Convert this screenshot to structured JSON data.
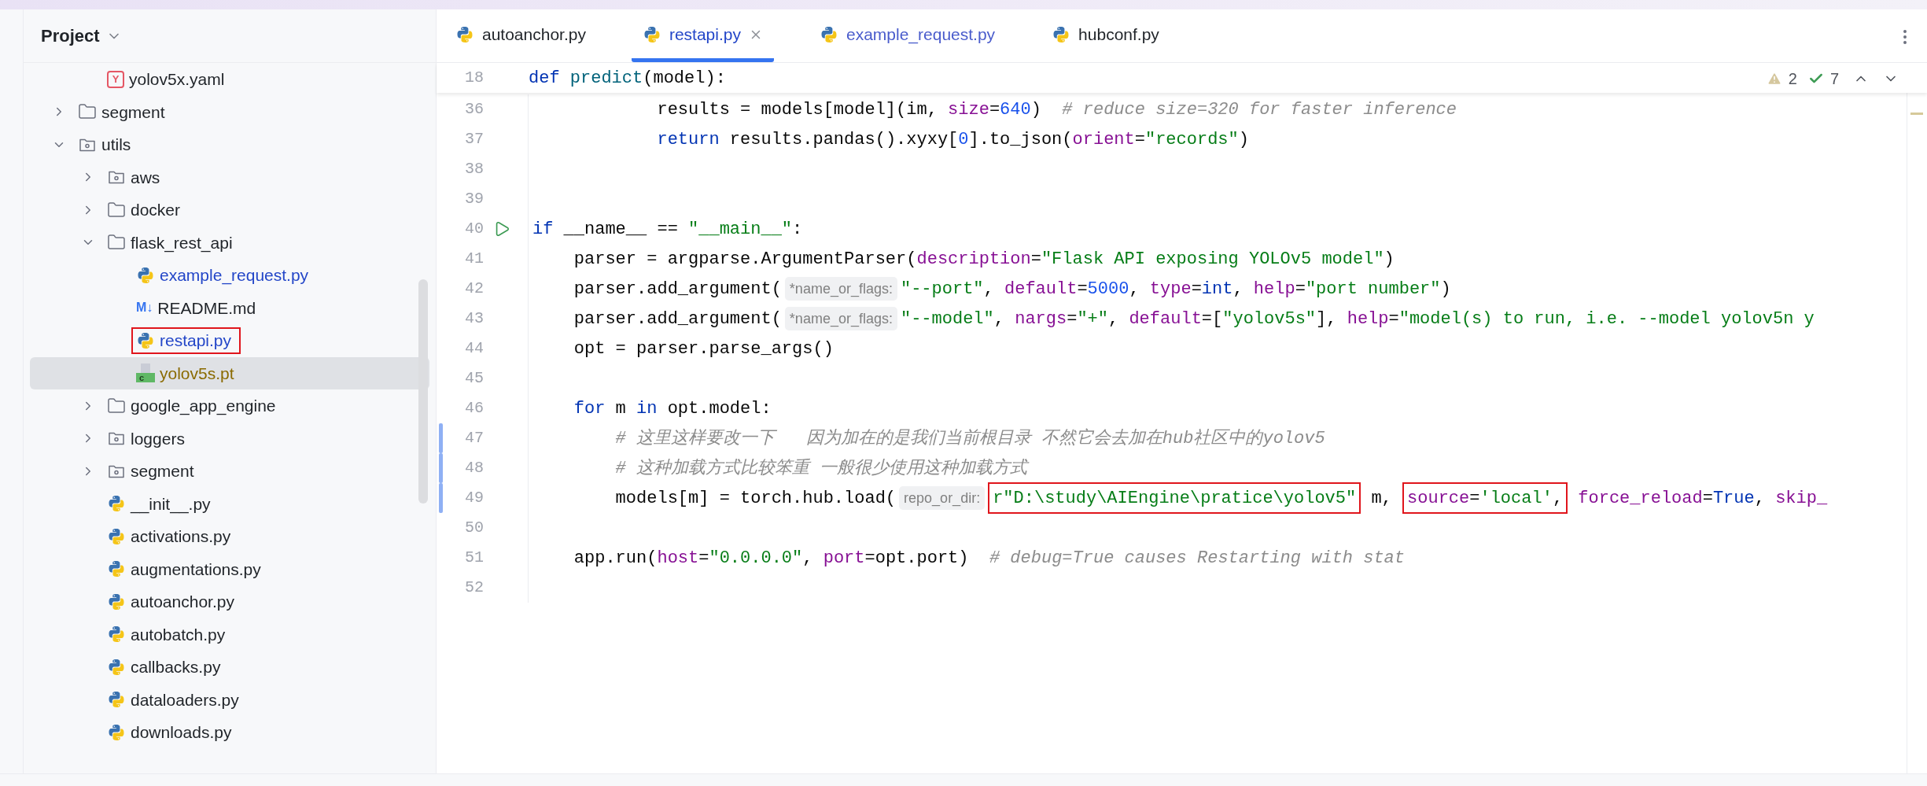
{
  "project_panel": {
    "title": "Project",
    "tree_partial": [
      {
        "label": "yolov5x.yaml",
        "kind": "yaml",
        "icon_label": "Y",
        "modified": false,
        "ignored": false,
        "selected": false,
        "highlighted": false
      }
    ],
    "tree": [
      {
        "label": "segment",
        "kind": "folder",
        "modified": false,
        "ignored": false,
        "selected": false,
        "highlighted": false,
        "expanded": false
      },
      {
        "label": "utils",
        "kind": "package",
        "modified": false,
        "ignored": false,
        "selected": false,
        "highlighted": false,
        "expanded": true,
        "children": [
          {
            "label": "aws",
            "kind": "package",
            "modified": false,
            "ignored": false,
            "selected": false,
            "highlighted": false,
            "expanded": false
          },
          {
            "label": "docker",
            "kind": "folder",
            "modified": false,
            "ignored": false,
            "selected": false,
            "highlighted": false,
            "expanded": false
          },
          {
            "label": "flask_rest_api",
            "kind": "folder",
            "modified": false,
            "ignored": false,
            "selected": false,
            "highlighted": false,
            "expanded": true,
            "children": [
              {
                "label": "example_request.py",
                "kind": "python",
                "modified": true,
                "ignored": false,
                "selected": false,
                "highlighted": false
              },
              {
                "label": "README.md",
                "kind": "markdown",
                "icon_label": "M↓",
                "modified": false,
                "ignored": false,
                "selected": false,
                "highlighted": false
              },
              {
                "label": "restapi.py",
                "kind": "python",
                "modified": true,
                "ignored": false,
                "selected": false,
                "highlighted": true
              },
              {
                "label": "yolov5s.pt",
                "kind": "binary",
                "icon_label": "c",
                "modified": false,
                "ignored": true,
                "selected": true,
                "highlighted": false
              }
            ]
          },
          {
            "label": "google_app_engine",
            "kind": "folder",
            "modified": false,
            "ignored": false,
            "selected": false,
            "highlighted": false,
            "expanded": false
          },
          {
            "label": "loggers",
            "kind": "package",
            "modified": false,
            "ignored": false,
            "selected": false,
            "highlighted": false,
            "expanded": false
          },
          {
            "label": "segment",
            "kind": "package",
            "modified": false,
            "ignored": false,
            "selected": false,
            "highlighted": false,
            "expanded": false
          },
          {
            "label": "__init__.py",
            "kind": "python",
            "modified": false,
            "ignored": false,
            "selected": false,
            "highlighted": false
          },
          {
            "label": "activations.py",
            "kind": "python",
            "modified": false,
            "ignored": false,
            "selected": false,
            "highlighted": false
          },
          {
            "label": "augmentations.py",
            "kind": "python",
            "modified": false,
            "ignored": false,
            "selected": false,
            "highlighted": false
          },
          {
            "label": "autoanchor.py",
            "kind": "python",
            "modified": false,
            "ignored": false,
            "selected": false,
            "highlighted": false
          },
          {
            "label": "autobatch.py",
            "kind": "python",
            "modified": false,
            "ignored": false,
            "selected": false,
            "highlighted": false
          },
          {
            "label": "callbacks.py",
            "kind": "python",
            "modified": false,
            "ignored": false,
            "selected": false,
            "highlighted": false
          },
          {
            "label": "dataloaders.py",
            "kind": "python",
            "modified": false,
            "ignored": false,
            "selected": false,
            "highlighted": false
          },
          {
            "label": "downloads.py",
            "kind": "python",
            "modified": false,
            "ignored": false,
            "selected": false,
            "highlighted": false
          }
        ]
      }
    ]
  },
  "editor": {
    "tabs": [
      {
        "label": "autoanchor.py",
        "modified": false,
        "selected": false
      },
      {
        "label": "restapi.py",
        "modified": true,
        "selected": true
      },
      {
        "label": "example_request.py",
        "modified": true,
        "selected": false
      },
      {
        "label": "hubconf.py",
        "modified": false,
        "selected": false
      }
    ],
    "inspections": {
      "warnings": "2",
      "typos": "7"
    },
    "sticky_line": {
      "number": "18",
      "tokens": [
        {
          "kind": "kw",
          "text": "def"
        },
        {
          "kind": "fn",
          "text": " predict"
        },
        {
          "kind": "plain",
          "text": "(model):"
        }
      ]
    },
    "lines": [
      {
        "number": "36",
        "run": false,
        "changed": false,
        "tokens": [
          {
            "kind": "plain",
            "text": "            results = models[model](im, "
          },
          {
            "kind": "param",
            "text": "size"
          },
          {
            "kind": "plain",
            "text": "="
          },
          {
            "kind": "num",
            "text": "640"
          },
          {
            "kind": "plain",
            "text": ")  "
          },
          {
            "kind": "comment",
            "text": "# reduce size=320 for faster inference"
          }
        ]
      },
      {
        "number": "37",
        "run": false,
        "changed": false,
        "tokens": [
          {
            "kind": "kw",
            "text": "            return"
          },
          {
            "kind": "plain",
            "text": " results.pandas().xyxy["
          },
          {
            "kind": "num",
            "text": "0"
          },
          {
            "kind": "plain",
            "text": "].to_json("
          },
          {
            "kind": "param",
            "text": "orient"
          },
          {
            "kind": "plain",
            "text": "="
          },
          {
            "kind": "str",
            "text": "\"records\""
          },
          {
            "kind": "plain",
            "text": ")"
          }
        ]
      },
      {
        "number": "38",
        "run": false,
        "changed": false
      },
      {
        "number": "39",
        "run": false,
        "changed": false
      },
      {
        "number": "40",
        "run": true,
        "changed": false,
        "tokens": [
          {
            "kind": "kw",
            "text": "if"
          },
          {
            "kind": "plain",
            "text": " __name__ == "
          },
          {
            "kind": "str",
            "text": "\"__main__\""
          },
          {
            "kind": "plain",
            "text": ":"
          }
        ]
      },
      {
        "number": "41",
        "run": false,
        "changed": false,
        "tokens": [
          {
            "kind": "plain",
            "text": "    parser = argparse.ArgumentParser("
          },
          {
            "kind": "param",
            "text": "description"
          },
          {
            "kind": "plain",
            "text": "="
          },
          {
            "kind": "str",
            "text": "\"Flask API exposing YOLOv5 model\""
          },
          {
            "kind": "plain",
            "text": ")"
          }
        ]
      },
      {
        "number": "42",
        "run": false,
        "changed": false,
        "tokens": [
          {
            "kind": "plain",
            "text": "    parser.add_argument("
          },
          {
            "kind": "hint",
            "text": "*name_or_flags:"
          },
          {
            "kind": "str",
            "text": "\"--port\""
          },
          {
            "kind": "plain",
            "text": ", "
          },
          {
            "kind": "param",
            "text": "default"
          },
          {
            "kind": "plain",
            "text": "="
          },
          {
            "kind": "num",
            "text": "5000"
          },
          {
            "kind": "plain",
            "text": ", "
          },
          {
            "kind": "param",
            "text": "type"
          },
          {
            "kind": "plain",
            "text": "="
          },
          {
            "kind": "kw",
            "text": "int"
          },
          {
            "kind": "plain",
            "text": ", "
          },
          {
            "kind": "param",
            "text": "help"
          },
          {
            "kind": "plain",
            "text": "="
          },
          {
            "kind": "str",
            "text": "\"port number\""
          },
          {
            "kind": "plain",
            "text": ")"
          }
        ]
      },
      {
        "number": "43",
        "run": false,
        "changed": false,
        "tokens": [
          {
            "kind": "plain",
            "text": "    parser.add_argument("
          },
          {
            "kind": "hint",
            "text": "*name_or_flags:"
          },
          {
            "kind": "str",
            "text": "\"--model\""
          },
          {
            "kind": "plain",
            "text": ", "
          },
          {
            "kind": "param",
            "text": "nargs"
          },
          {
            "kind": "plain",
            "text": "="
          },
          {
            "kind": "str",
            "text": "\"+\""
          },
          {
            "kind": "plain",
            "text": ", "
          },
          {
            "kind": "param",
            "text": "default"
          },
          {
            "kind": "plain",
            "text": "=["
          },
          {
            "kind": "str",
            "text": "\"yolov5s\""
          },
          {
            "kind": "plain",
            "text": "], "
          },
          {
            "kind": "param",
            "text": "help"
          },
          {
            "kind": "plain",
            "text": "="
          },
          {
            "kind": "str",
            "text": "\"model(s) to run, i.e. --model yolov5n y"
          }
        ]
      },
      {
        "number": "44",
        "run": false,
        "changed": false,
        "tokens": [
          {
            "kind": "plain",
            "text": "    opt = parser.parse_args()"
          }
        ]
      },
      {
        "number": "45",
        "run": false,
        "changed": false
      },
      {
        "number": "46",
        "run": false,
        "changed": false,
        "tokens": [
          {
            "kind": "kw",
            "text": "    for"
          },
          {
            "kind": "plain",
            "text": " m "
          },
          {
            "kind": "kw",
            "text": "in"
          },
          {
            "kind": "plain",
            "text": " opt.model:"
          }
        ]
      },
      {
        "number": "47",
        "run": false,
        "changed": true,
        "tokens": [
          {
            "kind": "comment",
            "text": "        # 这里这样要改一下   因为加在的是我们当前根目录 不然它会去加在hub社区中的yolov5"
          }
        ]
      },
      {
        "number": "48",
        "run": false,
        "changed": true,
        "tokens": [
          {
            "kind": "comment",
            "text": "        # 这种加载方式比较笨重 一般很少使用这种加载方式"
          }
        ]
      },
      {
        "number": "49",
        "run": false,
        "changed": true,
        "tokens": [
          {
            "kind": "plain",
            "text": "        models[m] = torch.hub.load("
          },
          {
            "kind": "hint",
            "text": "repo_or_dir:"
          },
          {
            "kind": "boxed",
            "tokens": [
              {
                "kind": "str",
                "text": "r\"D:\\study\\AIEngine\\pratice\\yolov5\""
              }
            ]
          },
          {
            "kind": "plain",
            "text": " m, "
          },
          {
            "kind": "boxed",
            "tokens": [
              {
                "kind": "param",
                "text": "source"
              },
              {
                "kind": "plain",
                "text": "="
              },
              {
                "kind": "str",
                "text": "'local'"
              },
              {
                "kind": "plain",
                "text": ","
              }
            ]
          },
          {
            "kind": "param",
            "text": " force_reload"
          },
          {
            "kind": "plain",
            "text": "="
          },
          {
            "kind": "kw",
            "text": "True"
          },
          {
            "kind": "plain",
            "text": ", "
          },
          {
            "kind": "param",
            "text": "skip_"
          }
        ]
      },
      {
        "number": "50",
        "run": false,
        "changed": false
      },
      {
        "number": "51",
        "run": false,
        "changed": false,
        "tokens": [
          {
            "kind": "plain",
            "text": "    app.run("
          },
          {
            "kind": "param",
            "text": "host"
          },
          {
            "kind": "plain",
            "text": "="
          },
          {
            "kind": "str",
            "text": "\"0.0.0.0\""
          },
          {
            "kind": "plain",
            "text": ", "
          },
          {
            "kind": "param",
            "text": "port"
          },
          {
            "kind": "plain",
            "text": "=opt.port)  "
          },
          {
            "kind": "comment",
            "text": "# debug=True causes Restarting with stat"
          }
        ]
      },
      {
        "number": "52",
        "run": false,
        "changed": false
      }
    ]
  }
}
